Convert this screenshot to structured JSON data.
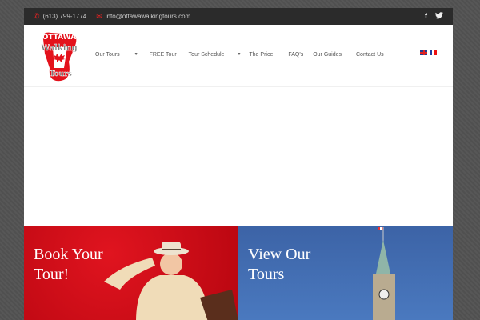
{
  "topbar": {
    "phone": "(613) 799-1774",
    "email": "info@ottawawalkingtours.com",
    "social": [
      "f",
      "twitter"
    ]
  },
  "logo": {
    "text": [
      "Ottawa",
      "Walking",
      "Tours"
    ]
  },
  "nav": {
    "items": [
      "Our Tours",
      "FREE Tour",
      "Tour Schedule",
      "The Price",
      "FAQ's",
      "Our Guides",
      "Contact Us"
    ]
  },
  "panels": {
    "book": "Book Your Tour!",
    "view": "View Our Tours"
  },
  "colors": {
    "brand_red": "#d7131c",
    "blue": "#4470b5",
    "topbar": "#2b2b2b"
  }
}
